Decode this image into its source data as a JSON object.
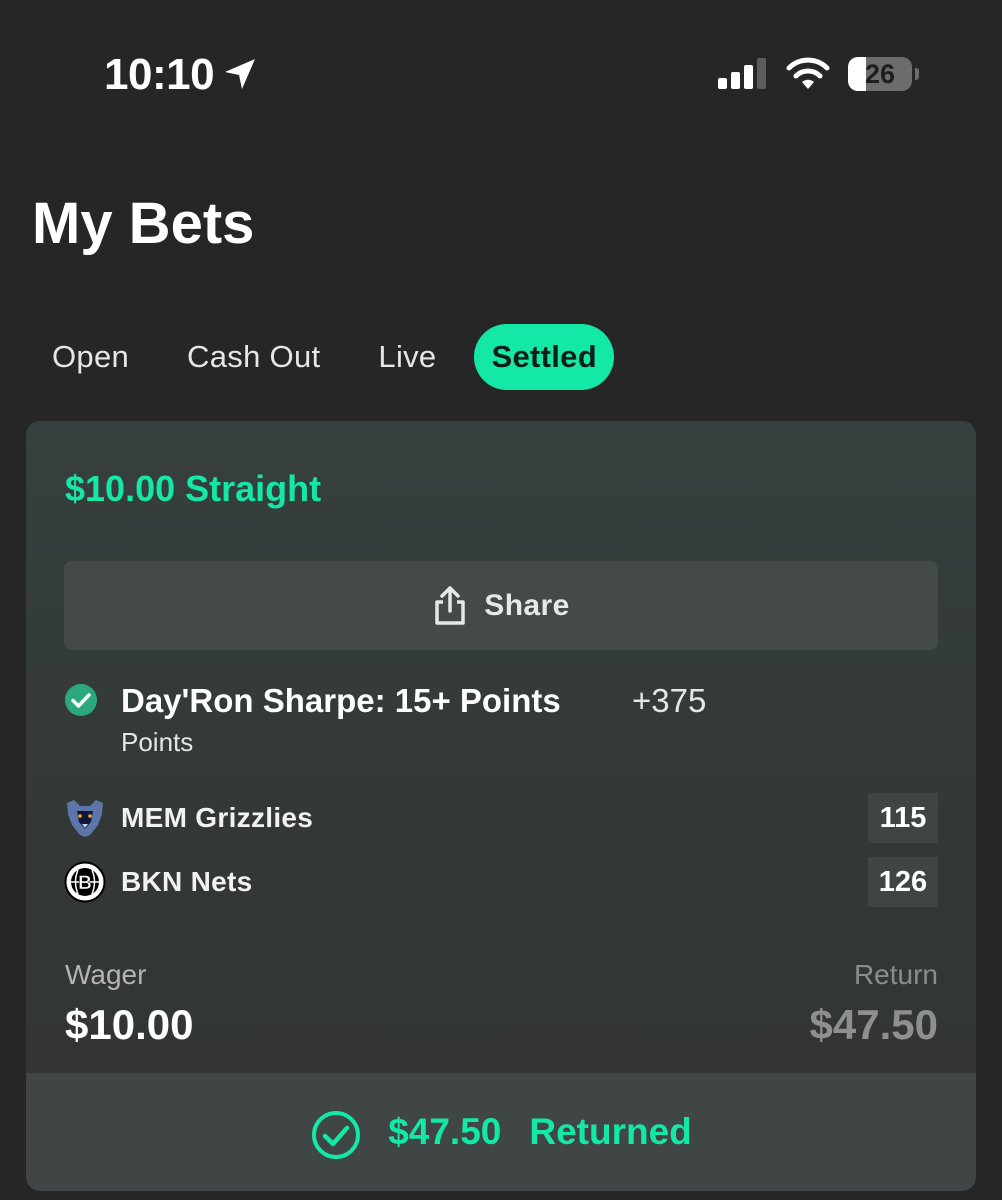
{
  "status_bar": {
    "time": "10:10",
    "battery_level": "26",
    "icons": [
      "location-arrow-icon",
      "cellular-signal-icon",
      "wifi-icon",
      "battery-icon"
    ]
  },
  "page": {
    "title": "My Bets"
  },
  "tabs": [
    {
      "label": "Open",
      "active": false
    },
    {
      "label": "Cash Out",
      "active": false
    },
    {
      "label": "Live",
      "active": false
    },
    {
      "label": "Settled",
      "active": true
    }
  ],
  "bet": {
    "header": "$10.00 Straight",
    "share_label": "Share",
    "selection": {
      "name": "Day'Ron Sharpe: 15+ Points",
      "odds": "+375",
      "market": "Points",
      "status_icon": "check-circle-icon"
    },
    "teams": [
      {
        "name": "MEM Grizzlies",
        "score": "115",
        "logo_icon": "grizzlies-logo-icon"
      },
      {
        "name": "BKN Nets",
        "score": "126",
        "logo_icon": "nets-logo-icon"
      }
    ],
    "wager_label": "Wager",
    "wager_value": "$10.00",
    "return_label": "Return",
    "return_value": "$47.50",
    "returned_amount": "$47.50",
    "returned_label": "Returned"
  },
  "colors": {
    "accent": "#14e8a7",
    "background": "#262626",
    "card": "#343a38"
  }
}
